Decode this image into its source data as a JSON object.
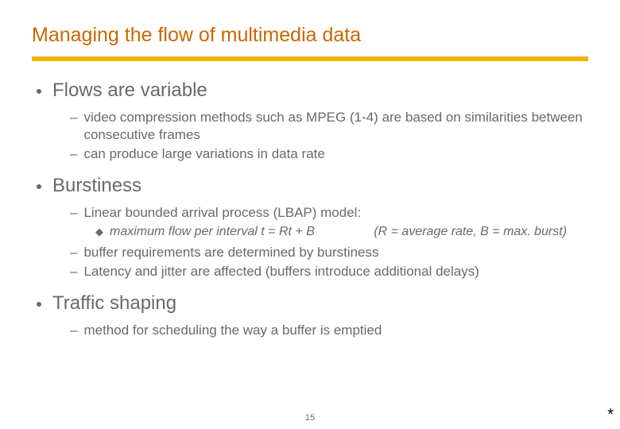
{
  "title": "Managing the flow of multimedia data",
  "sections": [
    {
      "heading": "Flows are variable",
      "dashes": [
        "video compression methods such as MPEG (1-4) are based on similarities between consecutive frames",
        "can produce large variations in data rate"
      ]
    },
    {
      "heading": "Burstiness",
      "dashes": [
        "Linear bounded arrival process (LBAP) model:",
        "buffer requirements are determined by burstiness",
        "Latency and jitter are affected (buffers introduce additional delays)"
      ],
      "diamond_after_first": {
        "main": "maximum flow per interval t = Rt + B",
        "side": "(R = average rate, B = max. burst)"
      }
    },
    {
      "heading": "Traffic shaping",
      "dashes": [
        "method for scheduling the way a buffer is emptied"
      ]
    }
  ],
  "page_number": "15",
  "asterisk": "*"
}
